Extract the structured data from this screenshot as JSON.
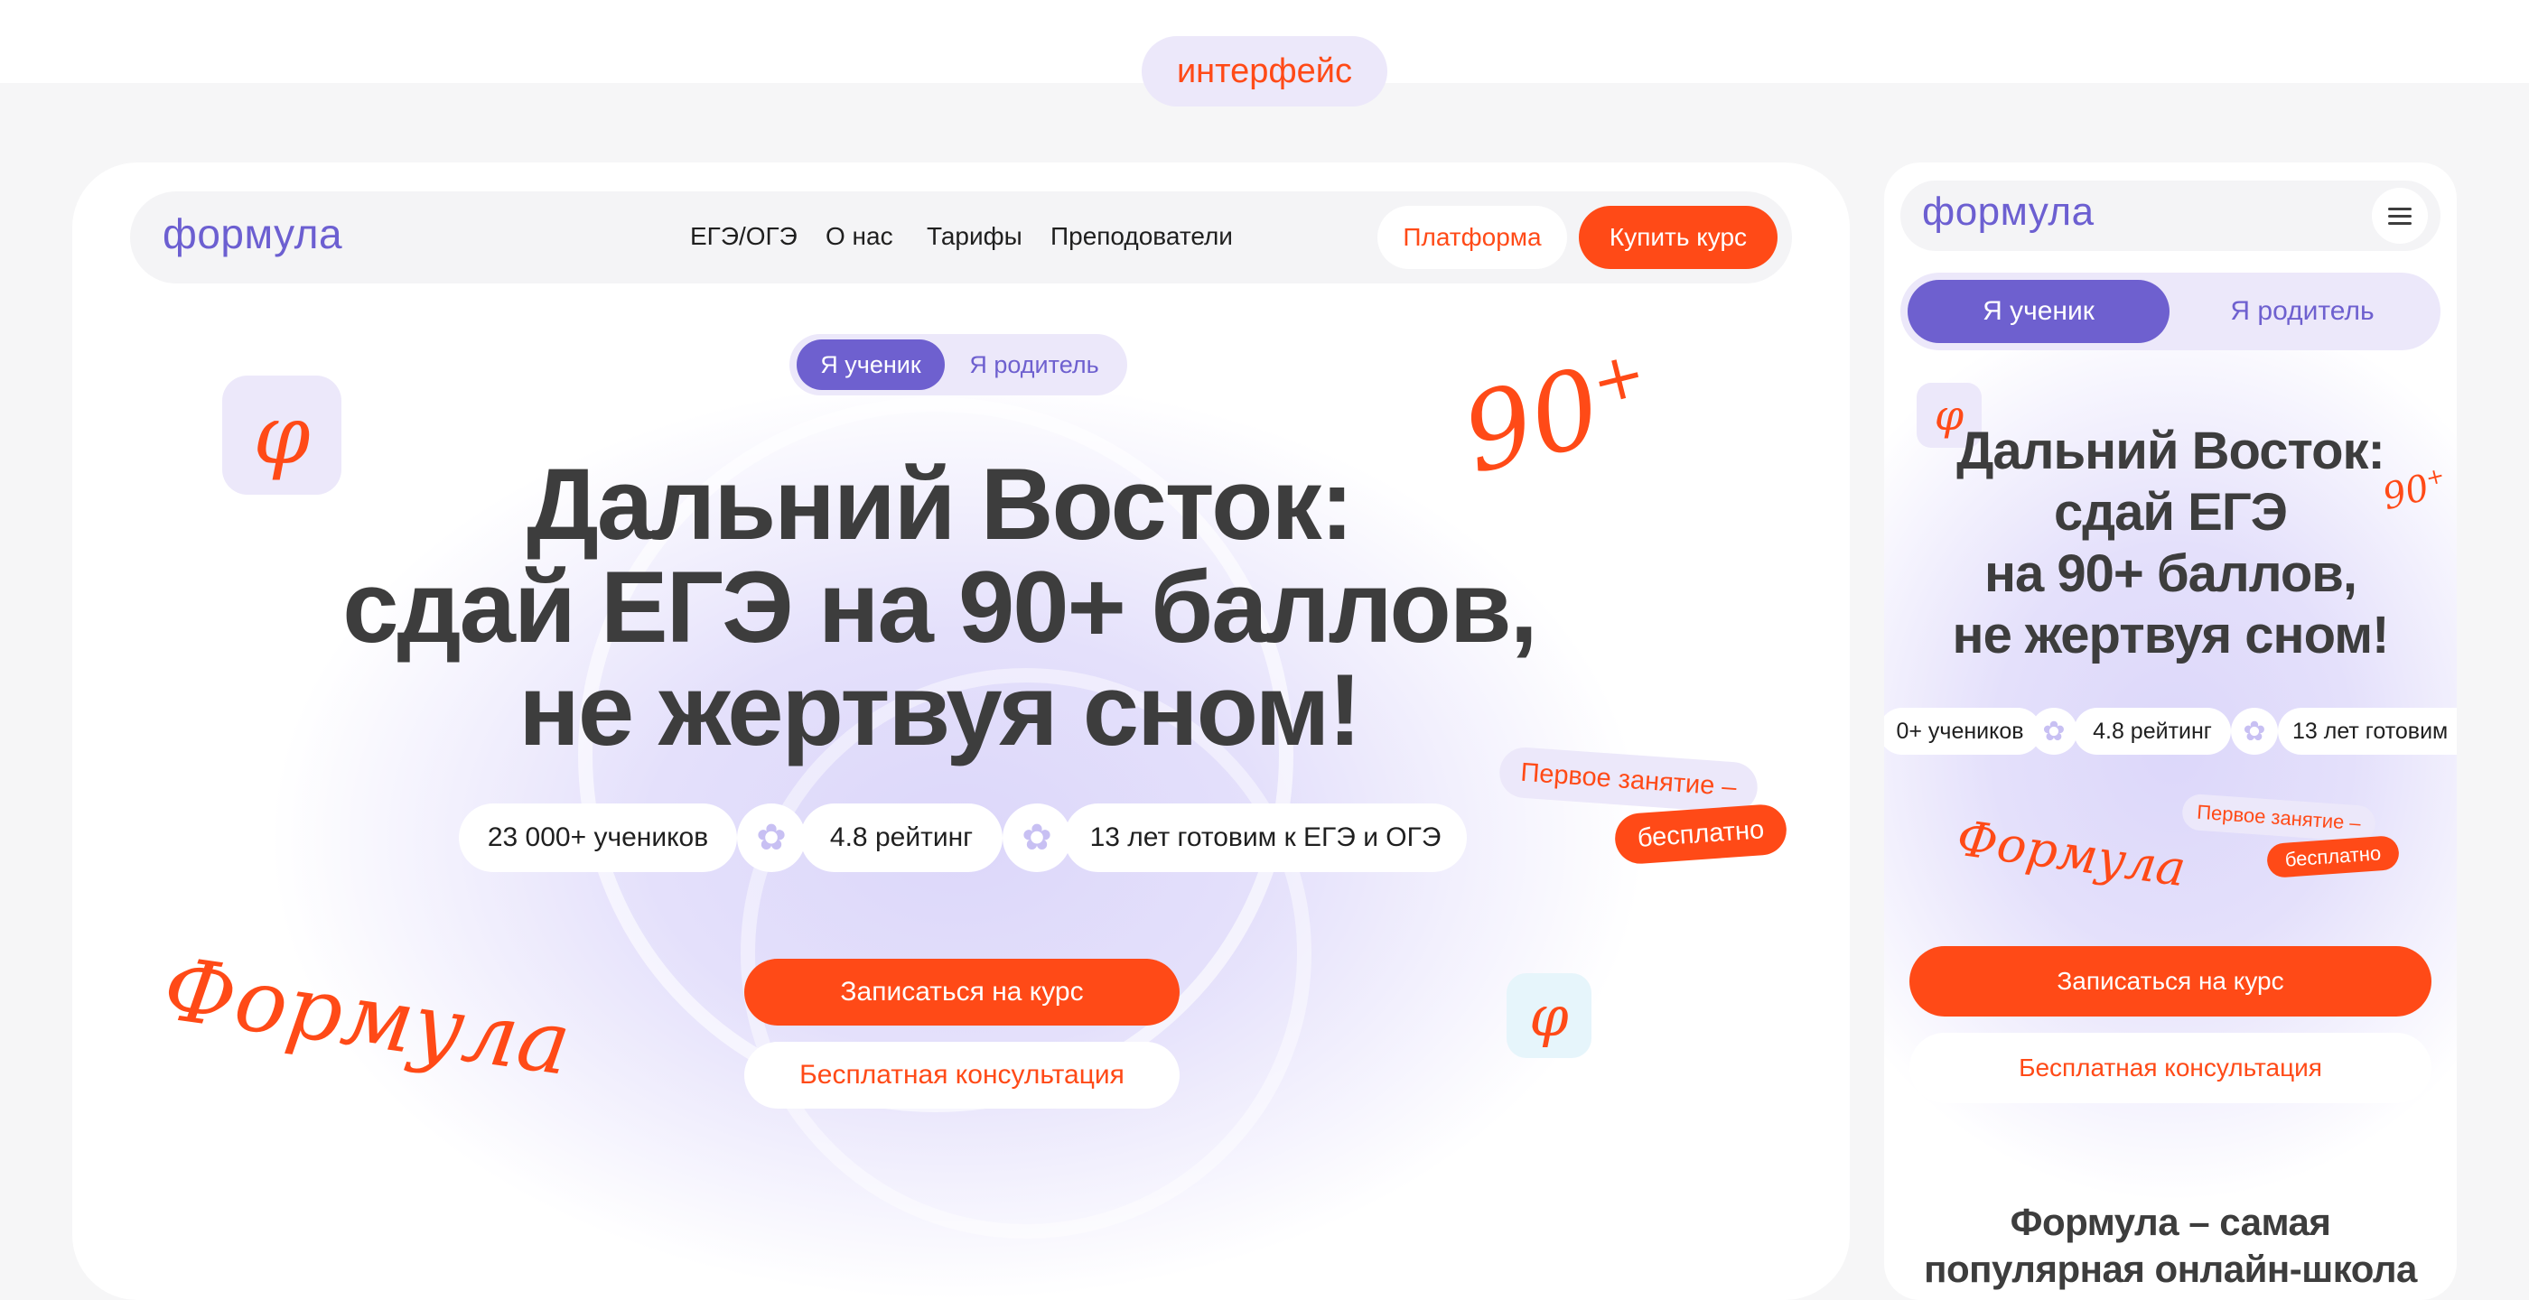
{
  "tag": "интерфейс",
  "desktop": {
    "logo": "формула",
    "nav": [
      "ЕГЭ/ОГЭ",
      "О нас",
      "Тарифы",
      "Преподователи"
    ],
    "platform_btn": "Платформа",
    "buy_btn": "Купить курс",
    "toggle": {
      "student": "Я ученик",
      "parent": "Я родитель",
      "selected": "student"
    },
    "headline": [
      "Дальний Восток:",
      "сдай ЕГЭ на 90+ баллов,",
      "не жертвуя сном!"
    ],
    "stats": [
      "23 000+ учеников",
      "4.8 рейтинг",
      "13 лет готовим к ЕГЭ и ОГЭ"
    ],
    "sticker_top": "Первое занятие –",
    "sticker_bottom": "бесплатно",
    "score": "90",
    "score_plus": "+",
    "signature": "Формула",
    "phi": "φ",
    "cta_primary": "Записаться на курс",
    "cta_secondary": "Бесплатная консультация"
  },
  "mobile": {
    "logo": "формула",
    "toggle": {
      "student": "Я ученик",
      "parent": "Я родитель",
      "selected": "student"
    },
    "headline": [
      "Дальний Восток:",
      "сдай ЕГЭ",
      "на 90+ баллов,",
      "не жертвуя сном!"
    ],
    "stats": [
      "0+ учеников",
      "4.8 рейтинг",
      "13 лет готовим"
    ],
    "sticker_top": "Первое занятие –",
    "sticker_bottom": "бесплатно",
    "score": "90",
    "score_plus": "+",
    "signature": "Формула",
    "phi": "φ",
    "cta_primary": "Записаться на курс",
    "cta_secondary": "Бесплатная консультация",
    "section_title": "Формула – самая",
    "section_title_2": "популярная онлайн-школа"
  },
  "colors": {
    "accent": "#ff4a17",
    "brand": "#6e60cf",
    "tint": "#ece8fa"
  }
}
